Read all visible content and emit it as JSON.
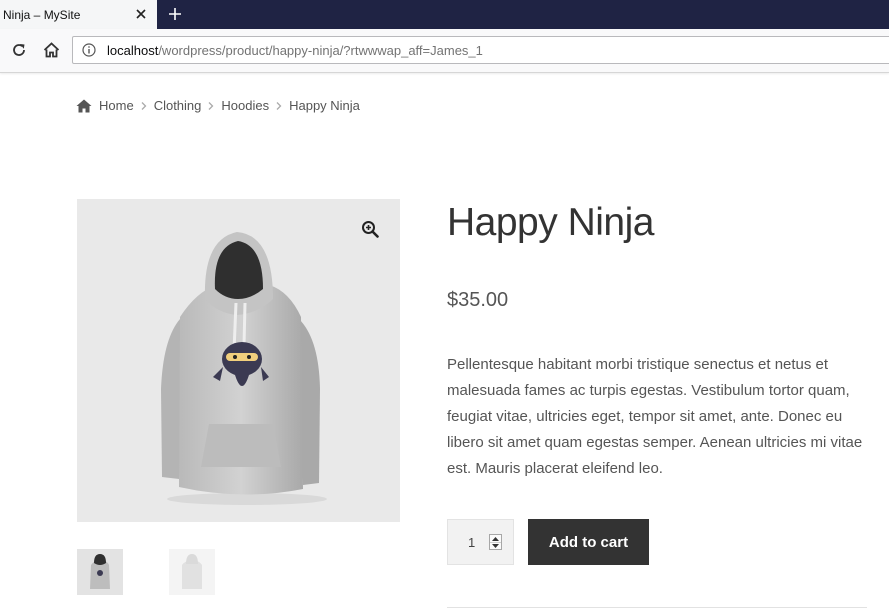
{
  "browser": {
    "tab_title": "Ninja – MySite",
    "url_host": "localhost",
    "url_path": "/wordpress/product/happy-ninja/?rtwwwap_aff=James_1"
  },
  "breadcrumb": {
    "items": [
      "Home",
      "Clothing",
      "Hoodies",
      "Happy Ninja"
    ]
  },
  "product": {
    "title": "Happy Ninja",
    "price": "$35.00",
    "description": "Pellentesque habitant morbi tristique senectus et netus et malesuada fames ac turpis egestas. Vestibulum tortor quam, feugiat vitae, ultricies eget, tempor sit amet, ante. Donec eu libero sit amet quam egestas semper. Aenean ultricies mi vitae est. Mauris placerat eleifend leo.",
    "quantity": "1",
    "add_to_cart_label": "Add to cart"
  },
  "icons": {
    "tab_close": "close-icon",
    "new_tab": "plus-icon",
    "reload": "reload-icon",
    "home_nav": "home-icon",
    "site_info": "info-icon",
    "breadcrumb_home": "home-icon",
    "breadcrumb_separator": "chevron-right-icon",
    "zoom": "magnifier-plus-icon"
  },
  "colors": {
    "tab_bar": "#1f2344",
    "button": "#333333",
    "gallery_bg": "#e9e9e9"
  }
}
